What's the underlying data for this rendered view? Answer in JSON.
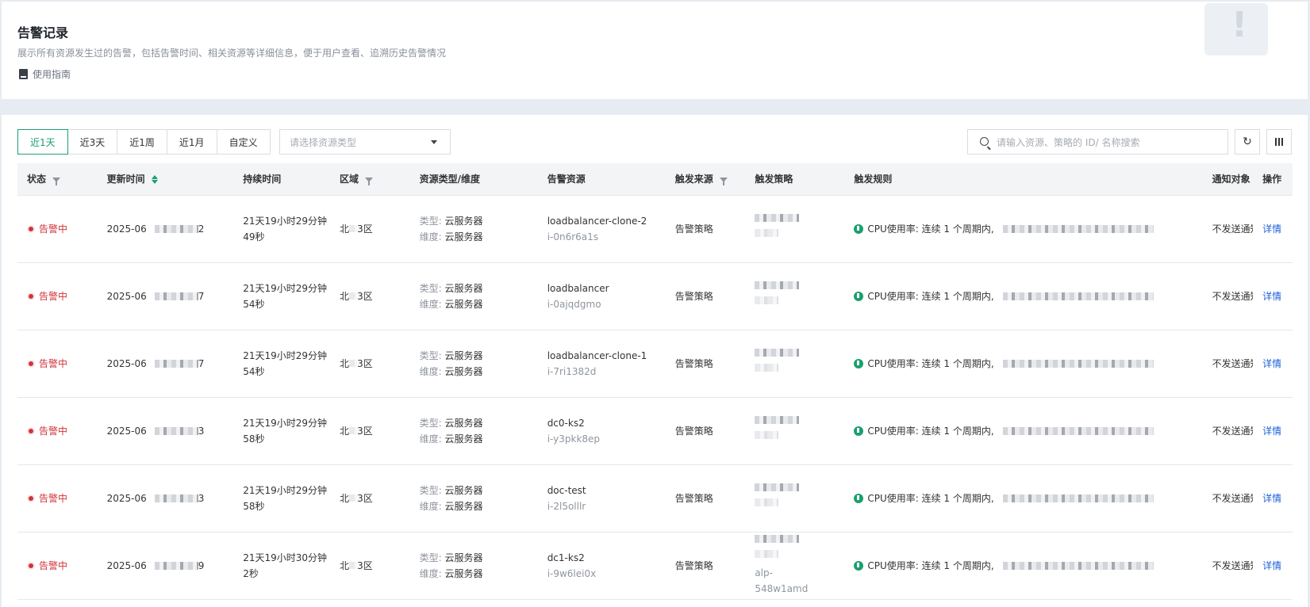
{
  "header": {
    "title": "告警记录",
    "description": "展示所有资源发生过的告警，包括告警时间、相关资源等详细信息，便于用户查看、追溯历史告警情况",
    "guide_label": "使用指南",
    "illustration_glyph": "!"
  },
  "toolbar": {
    "time_ranges": [
      "近1天",
      "近3天",
      "近1周",
      "近1月",
      "自定义"
    ],
    "active_range": "近1天",
    "resource_type_placeholder": "请选择资源类型",
    "search_placeholder": "请输入资源、策略的 ID/ 名称搜索",
    "refresh_glyph": "↻"
  },
  "table": {
    "columns": [
      "状态",
      "更新时间",
      "持续时间",
      "区域",
      "资源类型/维度",
      "告警资源",
      "触发来源",
      "触发策略",
      "触发规则",
      "通知对象",
      "操作"
    ],
    "rows": [
      {
        "status": "告警中",
        "update_time": "2025-06",
        "update_tail": "2",
        "duration": "21天19小时29分钟49秒",
        "region_head": "北",
        "region_tail": "3区",
        "type_label": "类型:",
        "type_value": "云服务器",
        "dim_label": "维度:",
        "dim_value": "云服务器",
        "resource_name": "loadbalancer-clone-2",
        "resource_id": "i-0n6r6a1s",
        "source": "告警策略",
        "policy_text": "",
        "rule": "CPU使用率: 连续 1 个周期内,",
        "notify": "不发送通知",
        "action": "详情"
      },
      {
        "status": "告警中",
        "update_time": "2025-06",
        "update_tail": "7",
        "duration": "21天19小时29分钟54秒",
        "region_head": "北",
        "region_tail": "3区",
        "type_label": "类型:",
        "type_value": "云服务器",
        "dim_label": "维度:",
        "dim_value": "云服务器",
        "resource_name": "loadbalancer",
        "resource_id": "i-0ajqdgmo",
        "source": "告警策略",
        "policy_text": "",
        "rule": "CPU使用率: 连续 1 个周期内,",
        "notify": "不发送通知",
        "action": "详情"
      },
      {
        "status": "告警中",
        "update_time": "2025-06",
        "update_tail": "7",
        "duration": "21天19小时29分钟54秒",
        "region_head": "北",
        "region_tail": "3区",
        "type_label": "类型:",
        "type_value": "云服务器",
        "dim_label": "维度:",
        "dim_value": "云服务器",
        "resource_name": "loadbalancer-clone-1",
        "resource_id": "i-7ri1382d",
        "source": "告警策略",
        "policy_text": "",
        "rule": "CPU使用率: 连续 1 个周期内,",
        "notify": "不发送通知",
        "action": "详情"
      },
      {
        "status": "告警中",
        "update_time": "2025-06",
        "update_tail": "3",
        "duration": "21天19小时29分钟58秒",
        "region_head": "北",
        "region_tail": "3区",
        "type_label": "类型:",
        "type_value": "云服务器",
        "dim_label": "维度:",
        "dim_value": "云服务器",
        "resource_name": "dc0-ks2",
        "resource_id": "i-y3pkk8ep",
        "source": "告警策略",
        "policy_text": "",
        "rule": "CPU使用率: 连续 1 个周期内,",
        "notify": "不发送通知",
        "action": "详情"
      },
      {
        "status": "告警中",
        "update_time": "2025-06",
        "update_tail": "3",
        "duration": "21天19小时29分钟58秒",
        "region_head": "北",
        "region_tail": "3区",
        "type_label": "类型:",
        "type_value": "云服务器",
        "dim_label": "维度:",
        "dim_value": "云服务器",
        "resource_name": "doc-test",
        "resource_id": "i-2l5olllr",
        "source": "告警策略",
        "policy_text": "",
        "rule": "CPU使用率: 连续 1 个周期内,",
        "notify": "不发送通知",
        "action": "详情"
      },
      {
        "status": "告警中",
        "update_time": "2025-06",
        "update_tail": "9",
        "duration": "21天19小时30分钟2秒",
        "region_head": "北",
        "region_tail": "3区",
        "type_label": "类型:",
        "type_value": "云服务器",
        "dim_label": "维度:",
        "dim_value": "云服务器",
        "resource_name": "dc1-ks2",
        "resource_id": "i-9w6lei0x",
        "source": "告警策略",
        "policy_text": "alp-548w1amd",
        "rule": "CPU使用率: 连续 1 个周期内,",
        "notify": "不发送通知",
        "action": "详情"
      }
    ]
  },
  "colors": {
    "accent": "#1aa06d",
    "alert": "#d0343b",
    "link": "#1d61d9"
  }
}
